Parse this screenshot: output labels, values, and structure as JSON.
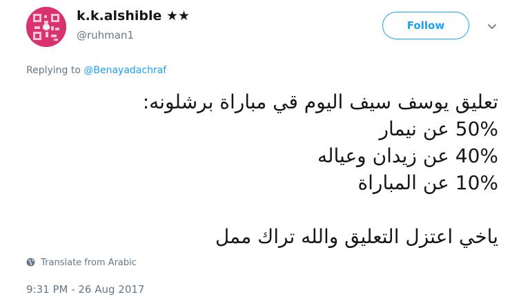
{
  "user": {
    "display_name": "k.k.alshible ★★",
    "handle": "@ruhman1",
    "avatar_icon": "qr-code-avatar",
    "avatar_color": "#d8336f"
  },
  "follow_button": {
    "label": "Follow",
    "color": "#1da1f2"
  },
  "more_menu_icon": "chevron-down-icon",
  "reply": {
    "prefix": "Replying to",
    "target": "@Benayadachraf"
  },
  "tweet": {
    "lines": [
      "تعليق يوسف سيف اليوم قي مباراة برشلونه:",
      "50% عن نيمار",
      "40% عن زيدان وعياله",
      "10% عن المباراة",
      "",
      "ياخي اعتزل التعليق والله تراك ممل"
    ]
  },
  "translate": {
    "icon": "globe-icon",
    "label": "Translate from Arabic"
  },
  "timestamp": "9:31 PM - 26 Aug 2017"
}
